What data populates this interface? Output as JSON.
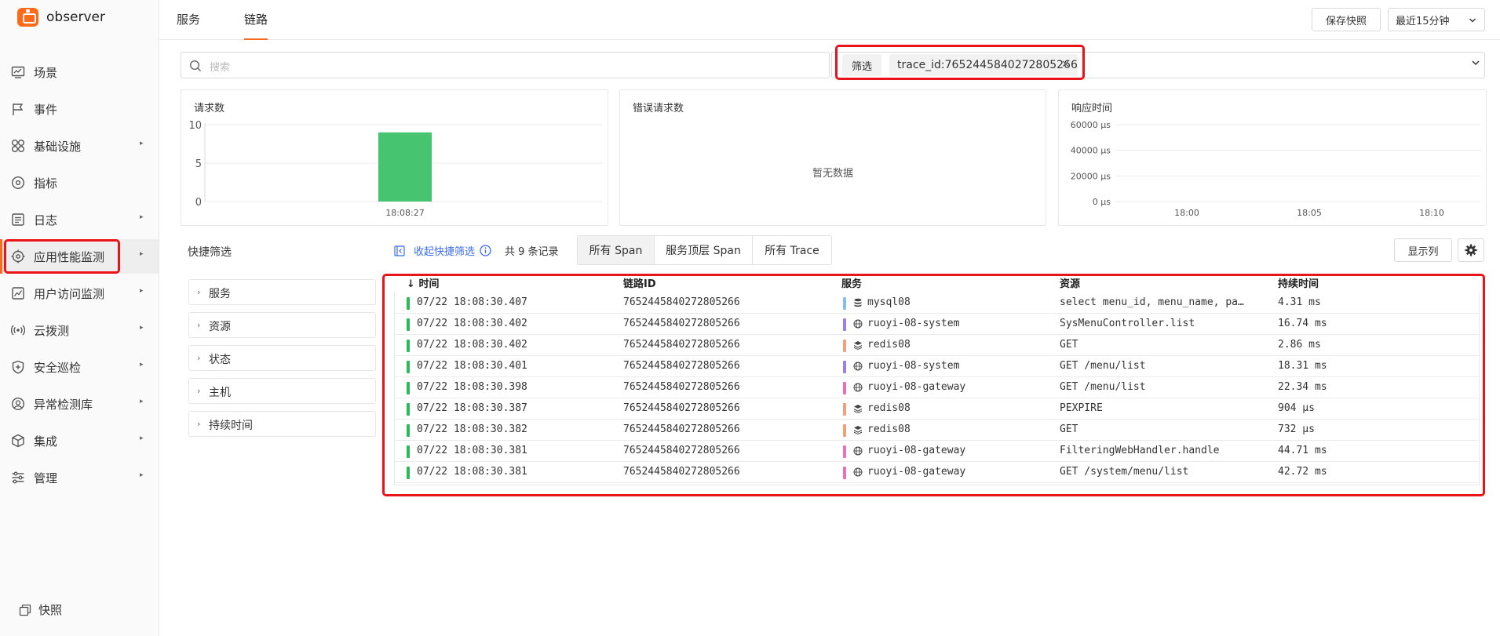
{
  "app": {
    "name": "observer"
  },
  "sidebar": {
    "items": [
      {
        "label": "场景",
        "icon": "dashboard-icon",
        "has_arrow": false
      },
      {
        "label": "事件",
        "icon": "flag-icon",
        "has_arrow": false
      },
      {
        "label": "基础设施",
        "icon": "grid-icon",
        "has_arrow": true
      },
      {
        "label": "指标",
        "icon": "gauge-icon",
        "has_arrow": false
      },
      {
        "label": "日志",
        "icon": "log-icon",
        "has_arrow": true
      },
      {
        "label": "应用性能监测",
        "icon": "apm-icon",
        "has_arrow": true,
        "active": true
      },
      {
        "label": "用户访问监测",
        "icon": "chart-icon",
        "has_arrow": true
      },
      {
        "label": "云拨测",
        "icon": "signal-icon",
        "has_arrow": true
      },
      {
        "label": "安全巡检",
        "icon": "shield-icon",
        "has_arrow": true
      },
      {
        "label": "异常检测库",
        "icon": "detector-icon",
        "has_arrow": true
      },
      {
        "label": "集成",
        "icon": "cube-icon",
        "has_arrow": true
      },
      {
        "label": "管理",
        "icon": "sliders-icon",
        "has_arrow": true
      }
    ],
    "snapshot_label": "快照"
  },
  "header": {
    "tabs": [
      {
        "label": "服务",
        "active": false
      },
      {
        "label": "链路",
        "active": true
      }
    ],
    "save_snapshot_label": "保存快照",
    "time_range": "最近15分钟"
  },
  "filters": {
    "search_placeholder": "搜索",
    "filter_label": "筛选",
    "tag": "trace_id:7652445840272805266"
  },
  "charts": {
    "requests": {
      "title": "请求数"
    },
    "errors": {
      "title": "错误请求数",
      "empty_text": "暂无数据"
    },
    "response": {
      "title": "响应时间"
    }
  },
  "chart_data": [
    {
      "type": "bar",
      "title": "请求数",
      "categories": [
        "18:08:27"
      ],
      "values": [
        9
      ],
      "ylim": [
        0,
        10
      ],
      "yticks": [
        "10",
        "5",
        "0"
      ],
      "grid": true,
      "color": "#46c46f"
    },
    {
      "type": "bar",
      "title": "错误请求数",
      "categories": [],
      "values": []
    },
    {
      "type": "line",
      "title": "响应时间",
      "x": [
        "18:00",
        "18:05",
        "18:10"
      ],
      "values": [],
      "ylim": [
        0,
        60000
      ],
      "yticks": [
        "60000 μs",
        "40000 μs",
        "20000 μs",
        "0 μs"
      ],
      "grid": true
    }
  ],
  "quick_filter": {
    "title": "快捷筛选",
    "collapse_label": "收起快捷筛选",
    "record_count": "共 9 条记录",
    "facets": [
      "服务",
      "资源",
      "状态",
      "主机",
      "持续时间"
    ]
  },
  "span_modes": [
    {
      "label": "所有 Span",
      "active": true
    },
    {
      "label": "服务顶层 Span",
      "active": false
    },
    {
      "label": "所有 Trace",
      "active": false
    }
  ],
  "columns_button": "显示列",
  "table": {
    "headers": {
      "time": "时间",
      "sort": "↓",
      "trace_id": "链路ID",
      "service": "服务",
      "resource": "资源",
      "duration": "持续时间"
    },
    "rows": [
      {
        "time": "07/22 18:08:30.407",
        "trace_id": "7652445840272805266",
        "service": "mysql08",
        "service_icon": "database-icon",
        "service_color": "#86bff5",
        "resource": "select menu_id, menu_name, pa…",
        "duration": "4.31 ms"
      },
      {
        "time": "07/22 18:08:30.402",
        "trace_id": "7652445840272805266",
        "service": "ruoyi-08-system",
        "service_icon": "globe-icon",
        "service_color": "#9b7ff0",
        "resource": "SysMenuController.list",
        "duration": "16.74 ms"
      },
      {
        "time": "07/22 18:08:30.402",
        "trace_id": "7652445840272805266",
        "service": "redis08",
        "service_icon": "stack-icon",
        "service_color": "#f5a07a",
        "resource": "GET",
        "duration": "2.86 ms"
      },
      {
        "time": "07/22 18:08:30.401",
        "trace_id": "7652445840272805266",
        "service": "ruoyi-08-system",
        "service_icon": "globe-icon",
        "service_color": "#9b7ff0",
        "resource": "GET /menu/list",
        "duration": "18.31 ms"
      },
      {
        "time": "07/22 18:08:30.398",
        "trace_id": "7652445840272805266",
        "service": "ruoyi-08-gateway",
        "service_icon": "globe-icon",
        "service_color": "#ee6fb5",
        "resource": "GET /menu/list",
        "duration": "22.34 ms"
      },
      {
        "time": "07/22 18:08:30.387",
        "trace_id": "7652445840272805266",
        "service": "redis08",
        "service_icon": "stack-icon",
        "service_color": "#f5a07a",
        "resource": "PEXPIRE",
        "duration": "904 μs"
      },
      {
        "time": "07/22 18:08:30.382",
        "trace_id": "7652445840272805266",
        "service": "redis08",
        "service_icon": "stack-icon",
        "service_color": "#f5a07a",
        "resource": "GET",
        "duration": "732 μs"
      },
      {
        "time": "07/22 18:08:30.381",
        "trace_id": "7652445840272805266",
        "service": "ruoyi-08-gateway",
        "service_icon": "globe-icon",
        "service_color": "#ee6fb5",
        "resource": "FilteringWebHandler.handle",
        "duration": "44.71 ms"
      },
      {
        "time": "07/22 18:08:30.381",
        "trace_id": "7652445840272805266",
        "service": "ruoyi-08-gateway",
        "service_icon": "globe-icon",
        "service_color": "#ee6fb5",
        "resource": "GET /system/menu/list",
        "duration": "42.72 ms"
      }
    ]
  },
  "colors": {
    "accent": "#ff6a1a",
    "link": "#3b6cf6",
    "highlight": "#e8141a",
    "success": "#2eb85c"
  }
}
